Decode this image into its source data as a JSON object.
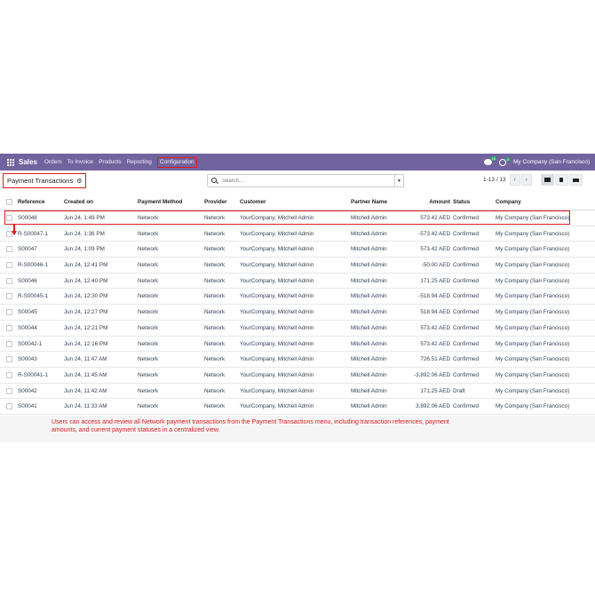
{
  "navbar": {
    "app_name": "Sales",
    "menu": [
      "Orders",
      "To Invoice",
      "Products",
      "Reporting",
      "Configuration"
    ],
    "messages_badge": "10",
    "activities_badge": "4",
    "company": "My Company (San Francisco)"
  },
  "control": {
    "title": "Payment Transactions",
    "search_placeholder": "Search...",
    "pager": "1-13 / 13"
  },
  "table": {
    "headers": {
      "reference": "Reference",
      "created_on": "Created on",
      "payment_method": "Payment Method",
      "provider": "Provider",
      "customer": "Customer",
      "partner_name": "Partner Name",
      "amount": "Amount",
      "status": "Status",
      "company": "Company"
    },
    "rows": [
      {
        "reference": "S00048",
        "created_on": "Jun 24, 1:49 PM",
        "payment_method": "Network",
        "provider": "Network",
        "customer": "YourCompany, Mitchell Admin",
        "partner_name": "Mitchell Admin",
        "amount": "573.42 AED",
        "status": "Confirmed",
        "company": "My Company (San Francisco)"
      },
      {
        "reference": "R-S00047-1",
        "created_on": "Jun 24, 1:36 PM",
        "payment_method": "Network",
        "provider": "Network",
        "customer": "YourCompany, Mitchell Admin",
        "partner_name": "Mitchell Admin",
        "amount": "-573.42 AED",
        "status": "Confirmed",
        "company": "My Company (San Francisco)"
      },
      {
        "reference": "S00047",
        "created_on": "Jun 24, 1:09 PM",
        "payment_method": "Network",
        "provider": "Network",
        "customer": "YourCompany, Mitchell Admin",
        "partner_name": "Mitchell Admin",
        "amount": "573.42 AED",
        "status": "Confirmed",
        "company": "My Company (San Francisco)"
      },
      {
        "reference": "R-S00046-1",
        "created_on": "Jun 24, 12:41 PM",
        "payment_method": "Network",
        "provider": "Network",
        "customer": "YourCompany, Mitchell Admin",
        "partner_name": "Mitchell Admin",
        "amount": "-50.00 AED",
        "status": "Confirmed",
        "company": "My Company (San Francisco)"
      },
      {
        "reference": "S00046",
        "created_on": "Jun 24, 12:40 PM",
        "payment_method": "Network",
        "provider": "Network",
        "customer": "YourCompany, Mitchell Admin",
        "partner_name": "Mitchell Admin",
        "amount": "171.25 AED",
        "status": "Confirmed",
        "company": "My Company (San Francisco)"
      },
      {
        "reference": "R-S00045-1",
        "created_on": "Jun 24, 12:30 PM",
        "payment_method": "Network",
        "provider": "Network",
        "customer": "YourCompany, Mitchell Admin",
        "partner_name": "Mitchell Admin",
        "amount": "-518.94 AED",
        "status": "Confirmed",
        "company": "My Company (San Francisco)"
      },
      {
        "reference": "S00045",
        "created_on": "Jun 24, 12:27 PM",
        "payment_method": "Network",
        "provider": "Network",
        "customer": "YourCompany, Mitchell Admin",
        "partner_name": "Mitchell Admin",
        "amount": "518.94 AED",
        "status": "Confirmed",
        "company": "My Company (San Francisco)"
      },
      {
        "reference": "S00044",
        "created_on": "Jun 24, 12:21 PM",
        "payment_method": "Network",
        "provider": "Network",
        "customer": "YourCompany, Mitchell Admin",
        "partner_name": "Mitchell Admin",
        "amount": "573.42 AED",
        "status": "Confirmed",
        "company": "My Company (San Francisco)"
      },
      {
        "reference": "S00042-1",
        "created_on": "Jun 24, 12:16 PM",
        "payment_method": "Network",
        "provider": "Network",
        "customer": "YourCompany, Mitchell Admin",
        "partner_name": "Mitchell Admin",
        "amount": "573.42 AED",
        "status": "Confirmed",
        "company": "My Company (San Francisco)"
      },
      {
        "reference": "S00043",
        "created_on": "Jun 24, 11:47 AM",
        "payment_method": "Network",
        "provider": "Network",
        "customer": "YourCompany, Mitchell Admin",
        "partner_name": "Mitchell Admin",
        "amount": "726.51 AED",
        "status": "Confirmed",
        "company": "My Company (San Francisco)"
      },
      {
        "reference": "R-S00041-1",
        "created_on": "Jun 24, 11:45 AM",
        "payment_method": "Network",
        "provider": "Network",
        "customer": "YourCompany, Mitchell Admin",
        "partner_name": "Mitchell Admin",
        "amount": "-3,892.06 AED",
        "status": "Confirmed",
        "company": "My Company (San Francisco)"
      },
      {
        "reference": "S00042",
        "created_on": "Jun 24, 11:42 AM",
        "payment_method": "Network",
        "provider": "Network",
        "customer": "YourCompany, Mitchell Admin",
        "partner_name": "Mitchell Admin",
        "amount": "171.25 AED",
        "status": "Draft",
        "company": "My Company (San Francisco)"
      },
      {
        "reference": "S00041",
        "created_on": "Jun 24, 11:33 AM",
        "payment_method": "Network",
        "provider": "Network",
        "customer": "YourCompany, Mitchell Admin",
        "partner_name": "Mitchell Admin",
        "amount": "3,892.06 AED",
        "status": "Confirmed",
        "company": "My Company (San Francisco)"
      }
    ]
  },
  "caption": "Users can access and review all Network payment transactions from the Payment Transactions menu, including transaction references, payment amounts, and current payment statuses in a centralized view.",
  "colors": {
    "navbar": "#71639e",
    "highlight": "#e0191d"
  }
}
